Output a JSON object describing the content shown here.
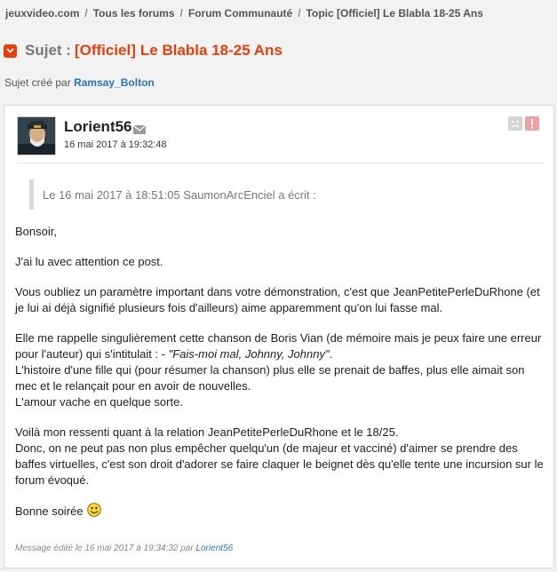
{
  "breadcrumb": {
    "items": [
      "jeuxvideo.com",
      "Tous les forums",
      "Forum Communauté",
      "Topic [Officiel] Le Blabla 18-25 Ans"
    ],
    "separator": "/"
  },
  "topic": {
    "prefix": "Sujet :",
    "tag": "[Officiel]",
    "title": "Le Blabla 18-25 Ans"
  },
  "creator": {
    "label": "Sujet créé par",
    "name": "Ramsay_Bolton"
  },
  "post": {
    "author": "Lorient56",
    "date": "16 mai 2017 à 19:32:48",
    "quote_header": "Le 16 mai 2017 à 18:51:05 SaumonArcEnciel a écrit :",
    "paragraphs": {
      "p1": "Bonsoir,",
      "p2": "J'ai lu avec attention ce post.",
      "p3": "Vous oubliez un paramètre important dans votre démonstration, c'est que JeanPetitePerleDuRhone (et je lui ai déjà signifié plusieurs fois d'ailleurs) aime apparemment qu'on lui fasse mal.",
      "p4a": "Elle me rappelle singulièrement cette chanson de Boris Vian (de mémoire mais je peux faire une erreur pour l'auteur) qui s'intitulait : - ",
      "p4quote": "\"Fais-moi mal, Johnny, Johnny\"",
      "p4b": ".",
      "p4c": "L'histoire d'une fille qui (pour résumer la chanson) plus elle se prenait de baffes, plus elle aimait son mec et le relançait pour en avoir de nouvelles.",
      "p4d": "L'amour vache en quelque sorte.",
      "p5a": "Voilà mon ressenti quant à la relation JeanPetitePerleDuRhone et le 18/25.",
      "p5b": "Donc, on ne peut pas non plus empêcher quelqu'un (de majeur et vacciné) d'aimer se prendre des baffes virtuelles, c'est son droit d'adorer se faire claquer le beignet dès qu'elle tente une incursion sur le forum évoqué.",
      "p6": "Bonne soirée"
    },
    "edited_label": "Message édité le 16 mai 2017 à 19:34:32 par",
    "edited_by": "Lorient56"
  },
  "colors": {
    "accent": "#e8400c",
    "link": "#2b73b8",
    "alert": "#f0a0a0"
  },
  "icons": [
    "chevron-down-icon",
    "mail-icon",
    "sad-face-icon",
    "alert-icon",
    "smiley-icon"
  ]
}
